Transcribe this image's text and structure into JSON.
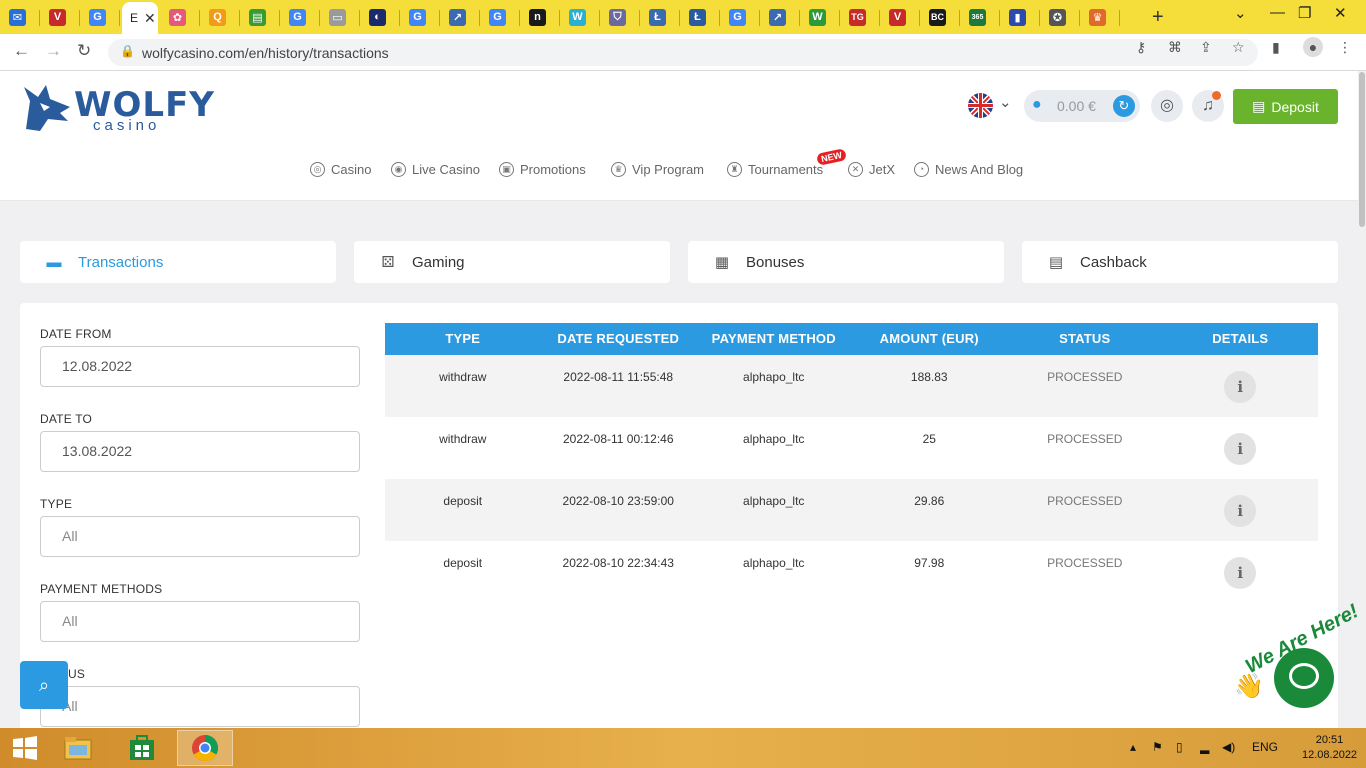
{
  "browser": {
    "active_tab_label": "E",
    "url": "wolfycasino.com/en/history/transactions",
    "favicons": [
      {
        "name": "mail-icon",
        "glyph": "✉",
        "color": "#2b6fd6"
      },
      {
        "name": "vivaldi-icon",
        "glyph": "V",
        "color": "#c62a2a"
      },
      {
        "name": "google-icon",
        "glyph": "G",
        "color": "#4285f4"
      },
      {
        "name": "flower-icon",
        "glyph": "✿",
        "color": "#e35a7a"
      },
      {
        "name": "search-q-icon",
        "glyph": "Q",
        "color": "#f29a1a"
      },
      {
        "name": "chat-icon",
        "glyph": "▤",
        "color": "#3a9a3a"
      },
      {
        "name": "google-icon",
        "glyph": "G",
        "color": "#4285f4"
      },
      {
        "name": "doc-icon",
        "glyph": "▭",
        "color": "#9a9a9a"
      },
      {
        "name": "globe-icon",
        "glyph": "◐",
        "color": "#1a2a6a"
      },
      {
        "name": "google-icon",
        "glyph": "G",
        "color": "#4285f4"
      },
      {
        "name": "share-icon",
        "glyph": "↗",
        "color": "#3a6ab0"
      },
      {
        "name": "google-icon",
        "glyph": "G",
        "color": "#4285f4"
      },
      {
        "name": "n-icon",
        "glyph": "n",
        "color": "#1a1a1a"
      },
      {
        "name": "w-icon",
        "glyph": "W",
        "color": "#2ab0d0"
      },
      {
        "name": "shield-icon",
        "glyph": "⛉",
        "color": "#6a6aa0"
      },
      {
        "name": "litecoin-icon",
        "glyph": "Ł",
        "color": "#3a6ab0"
      },
      {
        "name": "litecoin-icon",
        "glyph": "Ł",
        "color": "#2a5aa0"
      },
      {
        "name": "google-icon",
        "glyph": "G",
        "color": "#4285f4"
      },
      {
        "name": "share-icon",
        "glyph": "↗",
        "color": "#3a6ab0"
      },
      {
        "name": "w-green-icon",
        "glyph": "W",
        "color": "#2a9a3a"
      },
      {
        "name": "tg-icon",
        "glyph": "TG",
        "color": "#c62a2a"
      },
      {
        "name": "vivaldi-icon",
        "glyph": "V",
        "color": "#c62a2a"
      },
      {
        "name": "bc-icon",
        "glyph": "BC",
        "color": "#1a1a1a"
      },
      {
        "name": "bet365-icon",
        "glyph": "365",
        "color": "#1e7a3a"
      },
      {
        "name": "doc-blue-icon",
        "glyph": "▮",
        "color": "#2a4ab0"
      },
      {
        "name": "badge-icon",
        "glyph": "✪",
        "color": "#555555"
      },
      {
        "name": "crown-icon",
        "glyph": "♛",
        "color": "#e06a2a"
      }
    ]
  },
  "header": {
    "logo_text": "WOLFY",
    "logo_sub": "casino",
    "balance": "0.00 €",
    "deposit_label": "Deposit"
  },
  "nav": [
    {
      "label": "Casino",
      "glyph": "◎"
    },
    {
      "label": "Live Casino",
      "glyph": "◉"
    },
    {
      "label": "Promotions",
      "glyph": "▣"
    },
    {
      "label": "Vip Program",
      "glyph": "♛"
    },
    {
      "label": "Tournaments",
      "glyph": "♜"
    },
    {
      "label": "JetX",
      "glyph": "✕"
    },
    {
      "label": "News And Blog",
      "glyph": "◔"
    }
  ],
  "nav_badge": "NEW",
  "history_tabs": [
    {
      "label": "Transactions",
      "glyph": "▬"
    },
    {
      "label": "Gaming",
      "glyph": "⚄"
    },
    {
      "label": "Bonuses",
      "glyph": "▦"
    },
    {
      "label": "Cashback",
      "glyph": "▤"
    }
  ],
  "filters": {
    "date_from_label": "DATE FROM",
    "date_from": "12.08.2022",
    "date_to_label": "DATE TO",
    "date_to": "13.08.2022",
    "type_label": "TYPE",
    "type_value": "All",
    "payment_label": "PAYMENT METHODS",
    "payment_value": "All",
    "status_label": "US",
    "status_value": "All"
  },
  "table": {
    "columns": [
      "TYPE",
      "DATE REQUESTED",
      "PAYMENT METHOD",
      "AMOUNT (EUR)",
      "STATUS",
      "DETAILS"
    ],
    "rows": [
      {
        "type": "withdraw",
        "date": "2022-08-11 11:55:48",
        "method": "alphapo_ltc",
        "amount": "188.83",
        "status": "PROCESSED"
      },
      {
        "type": "withdraw",
        "date": "2022-08-11 00:12:46",
        "method": "alphapo_ltc",
        "amount": "25",
        "status": "PROCESSED"
      },
      {
        "type": "deposit",
        "date": "2022-08-10 23:59:00",
        "method": "alphapo_ltc",
        "amount": "29.86",
        "status": "PROCESSED"
      },
      {
        "type": "deposit",
        "date": "2022-08-10 22:34:43",
        "method": "alphapo_ltc",
        "amount": "97.98",
        "status": "PROCESSED"
      }
    ],
    "info_glyph": "i"
  },
  "chat": {
    "tagline": "We Are Here!"
  },
  "taskbar": {
    "lang": "ENG",
    "time": "20:51",
    "date": "12.08.2022"
  }
}
